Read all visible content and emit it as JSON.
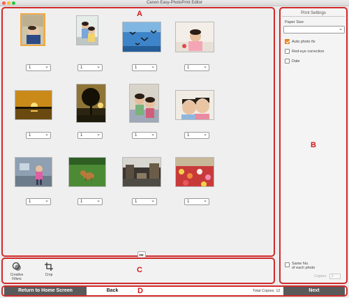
{
  "window": {
    "title": "Canon Easy-PhotoPrint Editor"
  },
  "regions": {
    "a": "A",
    "b": "B",
    "c": "C",
    "d": "D"
  },
  "photos": [
    {
      "name": "baby-sleeping",
      "copies": "1",
      "selected": true
    },
    {
      "name": "two-kids-sitting",
      "copies": "1",
      "selected": false
    },
    {
      "name": "birds-over-sea",
      "copies": "1",
      "selected": false
    },
    {
      "name": "toddler-on-bed",
      "copies": "1",
      "selected": false
    },
    {
      "name": "sunset-lake",
      "copies": "1",
      "selected": false
    },
    {
      "name": "tree-silhouette",
      "copies": "1",
      "selected": false
    },
    {
      "name": "siblings-indoor",
      "copies": "1",
      "selected": false
    },
    {
      "name": "two-girls-closeup",
      "copies": "1",
      "selected": false
    },
    {
      "name": "child-running",
      "copies": "1",
      "selected": false
    },
    {
      "name": "dog-on-grass",
      "copies": "1",
      "selected": false
    },
    {
      "name": "city-street",
      "copies": "1",
      "selected": false
    },
    {
      "name": "flower-market",
      "copies": "1",
      "selected": false
    }
  ],
  "tools": {
    "creative_filters": "Creative\nFilters",
    "crop": "Crop"
  },
  "settings": {
    "heading": "Print Settings",
    "paper_size_label": "Paper Size",
    "paper_size_value": "",
    "auto_photo_fix": "Auto photo fix",
    "auto_photo_fix_checked": true,
    "red_eye": "Red-eye correction",
    "red_eye_checked": false,
    "date": "Date",
    "date_checked": false,
    "same_no": "Same No.\nof each photo",
    "same_no_checked": false,
    "copies_label": "Copies",
    "copies_value": "1"
  },
  "footer": {
    "return_home": "Return to Home Screen",
    "back": "Back",
    "total_copies": "Total Copies: 12",
    "next": "Next"
  },
  "colors": {
    "accent_orange": "#f08a24",
    "region_outline": "#cf2a2a",
    "button_dark": "#5a5a5a"
  }
}
